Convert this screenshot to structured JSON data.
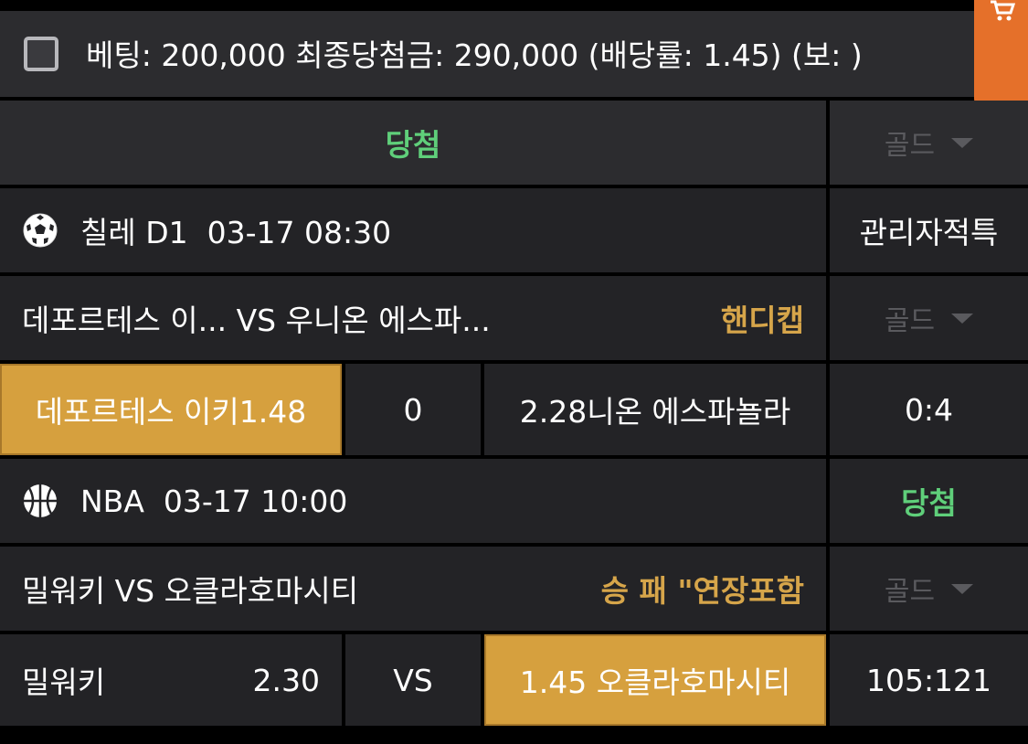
{
  "header": {
    "bet_summary": "베팅: 200,000 최종당첨금: 290,000 (배당률: 1.45) (보: )",
    "result": "당첨",
    "gold_label": "골드"
  },
  "cart": {
    "icon": "cart-icon",
    "color": "#e5702a"
  },
  "games": [
    {
      "sport_icon": "soccer-ball-icon",
      "league_time": "칠레 D1  03-17 08:30",
      "status": "관리자적특",
      "teams": "데포르테스 이... VS 우니온 에스파...",
      "market": "핸디캡",
      "gold_label": "골드",
      "home_label": "데포르테스 이키1.48",
      "handicap": "0",
      "away_label": "2.28니온 에스파뇰라",
      "score": "0:4"
    },
    {
      "sport_icon": "basketball-icon",
      "league_time": "NBA  03-17 10:00",
      "status": "당첨",
      "teams": "밀워키 VS 오클라호마시티",
      "market": "승 패 \"연장포함",
      "gold_label": "골드",
      "home_team": "밀워키",
      "home_odds": "2.30",
      "vs": "VS",
      "away_label": "1.45 오클라호마시티",
      "score": "105:121"
    }
  ],
  "colors": {
    "accent": "#d6a03e",
    "win": "#5fcf7a",
    "market": "#d6a54a"
  }
}
